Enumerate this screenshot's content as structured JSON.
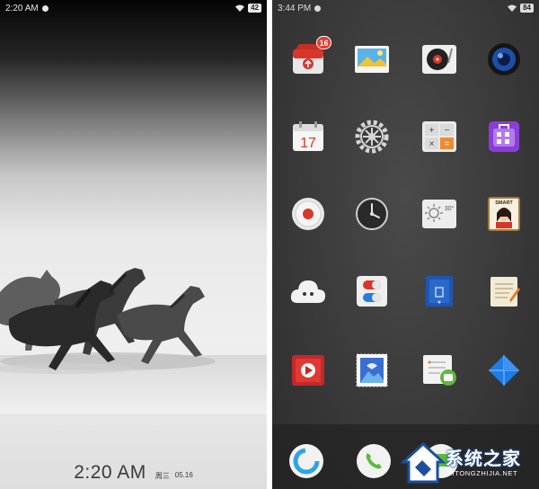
{
  "lock_screen": {
    "status_time": "2:20 AM",
    "battery": "42",
    "clock_time": "2:20 AM",
    "weekday": "周三",
    "date": "05.16"
  },
  "home_screen": {
    "status_time": "3:44 PM",
    "battery": "84",
    "apps": [
      {
        "name": "app-store-icon",
        "badge": "16"
      },
      {
        "name": "gallery-icon"
      },
      {
        "name": "music-player-icon"
      },
      {
        "name": "camera-lens-icon"
      },
      {
        "name": "calendar-icon",
        "date": "17"
      },
      {
        "name": "settings-gear-icon"
      },
      {
        "name": "calculator-icon"
      },
      {
        "name": "theme-store-icon"
      },
      {
        "name": "recorder-icon"
      },
      {
        "name": "clock-icon"
      },
      {
        "name": "weather-icon",
        "temp": "30°"
      },
      {
        "name": "contacts-smart-icon",
        "label": "SMART"
      },
      {
        "name": "cloud-icon"
      },
      {
        "name": "security-pills-icon"
      },
      {
        "name": "file-manager-icon"
      },
      {
        "name": "notes-icon"
      },
      {
        "name": "video-player-icon"
      },
      {
        "name": "stamp-photo-icon"
      },
      {
        "name": "messages-icon"
      },
      {
        "name": "browser-umbrella-icon"
      }
    ],
    "dock": [
      {
        "name": "dock-browser-icon"
      },
      {
        "name": "dock-phone-icon"
      },
      {
        "name": "dock-messages-icon"
      }
    ]
  },
  "watermark": {
    "text": "系统之家",
    "url": "XITONGZHIJIA.NET"
  },
  "colors": {
    "home_bg": "#3a3a3a",
    "badge_red": "#e23c2e",
    "accent_blue": "#2c7ae0"
  }
}
